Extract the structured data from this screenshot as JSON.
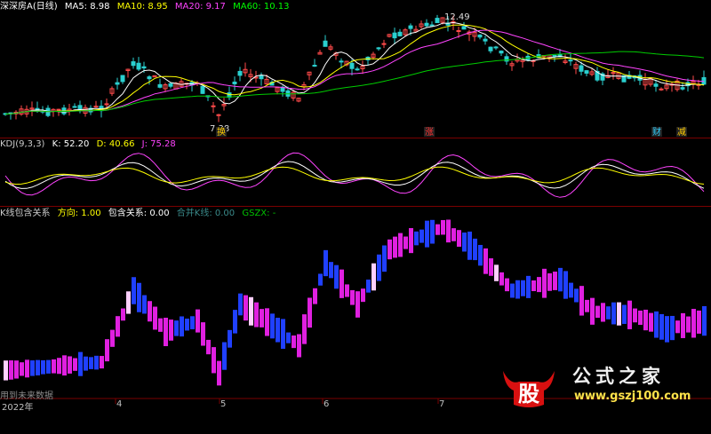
{
  "panel1": {
    "title": "深深房A(日线)",
    "ma5": "MA5: 8.98",
    "ma10": "MA10: 8.95",
    "ma20": "MA20: 9.17",
    "ma60": "MA60: 10.13",
    "high_label": "12.49",
    "low_label": "7.38",
    "markers": [
      "换",
      "涨",
      "",
      "财",
      "减"
    ],
    "colors": {
      "title": "#ffffff",
      "ma5": "#ffffff",
      "ma10": "#ffff00",
      "ma20": "#ff00ff",
      "ma60": "#00ff00"
    }
  },
  "panel2": {
    "title": "KDJ(9,3,3)",
    "k": "K: 52.20",
    "d": "D: 40.66",
    "j": "J: 75.28"
  },
  "panel3": {
    "title": "K线包含关系",
    "direction": "方向: 1.00",
    "contain": "包含关系: 0.00",
    "merge": "合并K线: 0.00",
    "gszx": "GSZX: -",
    "future_label": "用到未来数据"
  },
  "xaxis": {
    "labels": [
      "2022年",
      "4",
      "5",
      "6",
      "7"
    ]
  },
  "watermark": {
    "logo_char": "股",
    "cn": "公式之家",
    "url": "www.gszj100.com"
  },
  "chart_data": [
    {
      "type": "candlestick",
      "title": "深深房A(日线)",
      "series": [
        {
          "name": "MA5",
          "values": [
            8.98
          ]
        },
        {
          "name": "MA10",
          "values": [
            8.95
          ]
        },
        {
          "name": "MA20",
          "values": [
            9.17
          ]
        },
        {
          "name": "MA60",
          "values": [
            10.13
          ]
        }
      ],
      "annotations": [
        "12.49",
        "7.38"
      ]
    },
    {
      "type": "line",
      "title": "KDJ(9,3,3)",
      "series": [
        {
          "name": "K",
          "values": [
            52.2
          ]
        },
        {
          "name": "D",
          "values": [
            40.66
          ]
        },
        {
          "name": "J",
          "values": [
            75.28
          ]
        }
      ]
    },
    {
      "type": "bar",
      "title": "K线包含关系",
      "series": [
        {
          "name": "方向",
          "values": [
            1.0
          ]
        },
        {
          "name": "包含关系",
          "values": [
            0.0
          ]
        },
        {
          "name": "合并K线",
          "values": [
            0.0
          ]
        }
      ]
    }
  ]
}
